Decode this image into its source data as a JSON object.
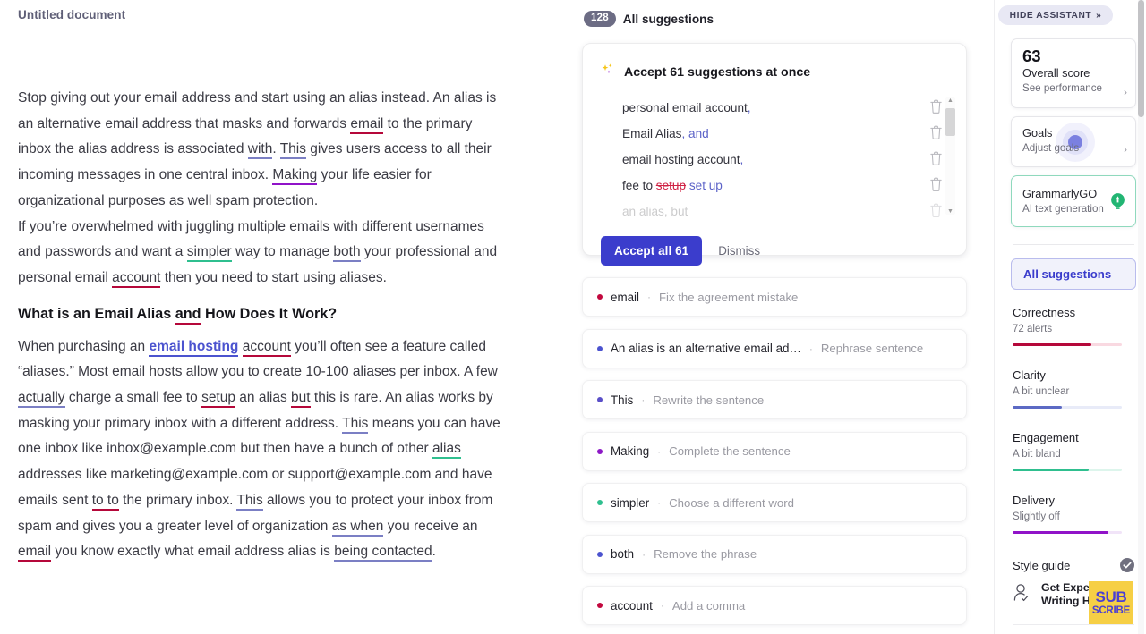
{
  "document": {
    "title": "Untitled document",
    "heading": "What is an Email Alias and How Does It Work?",
    "p1_a": "Stop giving out your email address and start using an alias instead. An alias is an alternative email address that masks and forwards ",
    "p1_email": "email",
    "p1_b": " to the primary inbox the alias address is associated ",
    "p1_with": "with",
    "p1_c": ". ",
    "p1_this": "This",
    "p1_d": " gives users access to all their incoming messages in one central inbox. ",
    "p1_making": "Making",
    "p1_e": " your life easier for organizational purposes as well spam protection.",
    "p2_a": "If you’re overwhelmed with juggling multiple emails with different usernames and passwords and want a ",
    "p2_simpler": "simpler",
    "p2_b": " way to manage ",
    "p2_both": "both",
    "p2_c": " your professional and personal email ",
    "p2_account": "account",
    "p2_d": " then you need to start using aliases.",
    "h_a": "What is an Email Alias ",
    "h_and": "and",
    "h_b": " How Does It Work?",
    "p3_a": "When purchasing an ",
    "p3_link": "email hosting",
    "p3_b": " ",
    "p3_account": "account",
    "p3_c": " you’ll often see a feature called “aliases.” Most email hosts allow you to create 10-100 aliases per inbox. A few ",
    "p3_actually": "actually",
    "p3_d": " charge a small fee to ",
    "p3_setup": "setup",
    "p3_e": " an alias ",
    "p3_but": "but",
    "p3_f": " this is rare. An alias works by masking your primary inbox with a different address. ",
    "p3_this1": "This",
    "p3_g": " means you can have one inbox like inbox@example.com but then have a bunch of other ",
    "p3_alias": "alias",
    "p3_h": " addresses like marketing@example.com or support@example.com and have emails sent ",
    "p3_toto": "to to",
    "p3_i": " the primary inbox. ",
    "p3_this2": "This",
    "p3_j": " allows you to protect your inbox from spam and gives you a greater level of organization ",
    "p3_aswhen": "as when",
    "p3_k": " you receive an ",
    "p3_email": "email",
    "p3_l": " you know exactly what email address alias is ",
    "p3_being": "being contacted",
    "p3_m": "."
  },
  "feed": {
    "count": "128",
    "title": "All suggestions",
    "accept_card": {
      "header": "Accept 61 suggestions at once",
      "items": [
        {
          "text": "personal email account",
          "comma": ",",
          "faded": false
        },
        {
          "text": "Email Alias",
          "comma": ", and",
          "faded": false
        },
        {
          "text": "email hosting account",
          "comma": ",",
          "faded": false
        },
        {
          "text": "fee to ",
          "strike": "setup",
          "replacement": " set up",
          "faded": false
        },
        {
          "text": "an alias",
          "comma": ", but",
          "faded": true
        }
      ],
      "accept_label": "Accept all 61",
      "dismiss_label": "Dismiss"
    },
    "cards": [
      {
        "word": "email",
        "action": "Fix the agreement mistake",
        "color": "#c2083e"
      },
      {
        "word": "An alias is an alternative email ad…",
        "action": "Rephrase sentence",
        "color": "#4b53cf"
      },
      {
        "word": "This",
        "action": "Rewrite the sentence",
        "color": "#5a4fc8"
      },
      {
        "word": "Making",
        "action": "Complete the sentence",
        "color": "#8d18c6"
      },
      {
        "word": "simpler",
        "action": "Choose a different word",
        "color": "#2fbf8f"
      },
      {
        "word": "both",
        "action": "Remove the phrase",
        "color": "#4b53cf"
      },
      {
        "word": "account",
        "action": "Add a comma",
        "color": "#c2083e"
      }
    ]
  },
  "assistant": {
    "hide_label": "HIDE ASSISTANT",
    "hide_chevrons": "»",
    "score": {
      "value": "63",
      "label": "Overall score",
      "sub": "See performance"
    },
    "goals": {
      "label": "Goals",
      "sub": "Adjust goals"
    },
    "grammarlygo": {
      "label": "GrammarlyGO",
      "sub": "AI text generation"
    },
    "all_suggestions_label": "All suggestions",
    "metrics": [
      {
        "name": "Correctness",
        "sub": "72 alerts",
        "percent": 72,
        "color": "#b5083a",
        "track": "#f9d9e1"
      },
      {
        "name": "Clarity",
        "sub": "A bit unclear",
        "percent": 45,
        "color": "#5c6ac4",
        "track": "#e8ebf8"
      },
      {
        "name": "Engagement",
        "sub": "A bit bland",
        "percent": 70,
        "color": "#2fbf8f",
        "track": "#ddf5ec"
      },
      {
        "name": "Delivery",
        "sub": "Slightly off",
        "percent": 88,
        "color": "#9013c8",
        "track": "#f1e4f8"
      }
    ],
    "style_guide_label": "Style guide",
    "expert_line1": "Get Expert",
    "expert_line2": "Writing Help"
  },
  "overlay": {
    "sub_top": "SUB",
    "sub_bottom": "SCRIBE"
  }
}
